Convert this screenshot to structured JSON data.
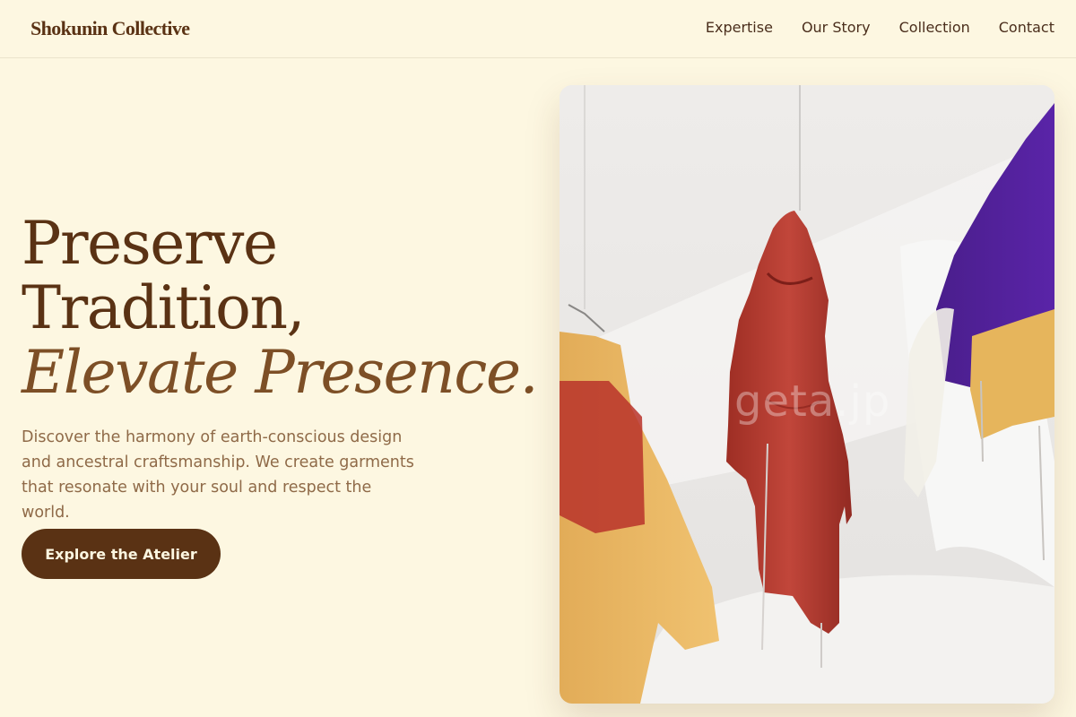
{
  "brand": {
    "name": "Shokunin Collective"
  },
  "nav": {
    "items": [
      {
        "label": "Expertise"
      },
      {
        "label": "Our Story"
      },
      {
        "label": "Collection"
      },
      {
        "label": "Contact"
      }
    ]
  },
  "hero": {
    "title_line1": "Preserve",
    "title_line2": "Tradition,",
    "title_line3": "Elevate Presence.",
    "description": "Discover the harmony of earth-conscious design and ancestral craftsmanship. We create garments that resonate with your soul and respect the world.",
    "cta_label": "Explore the Atelier"
  },
  "image": {
    "watermark": "geta.jp"
  },
  "colors": {
    "background": "#fdf7e1",
    "primary_brown": "#5a3214",
    "accent_brown": "#7d4f26",
    "body_text": "#8f6a48"
  }
}
